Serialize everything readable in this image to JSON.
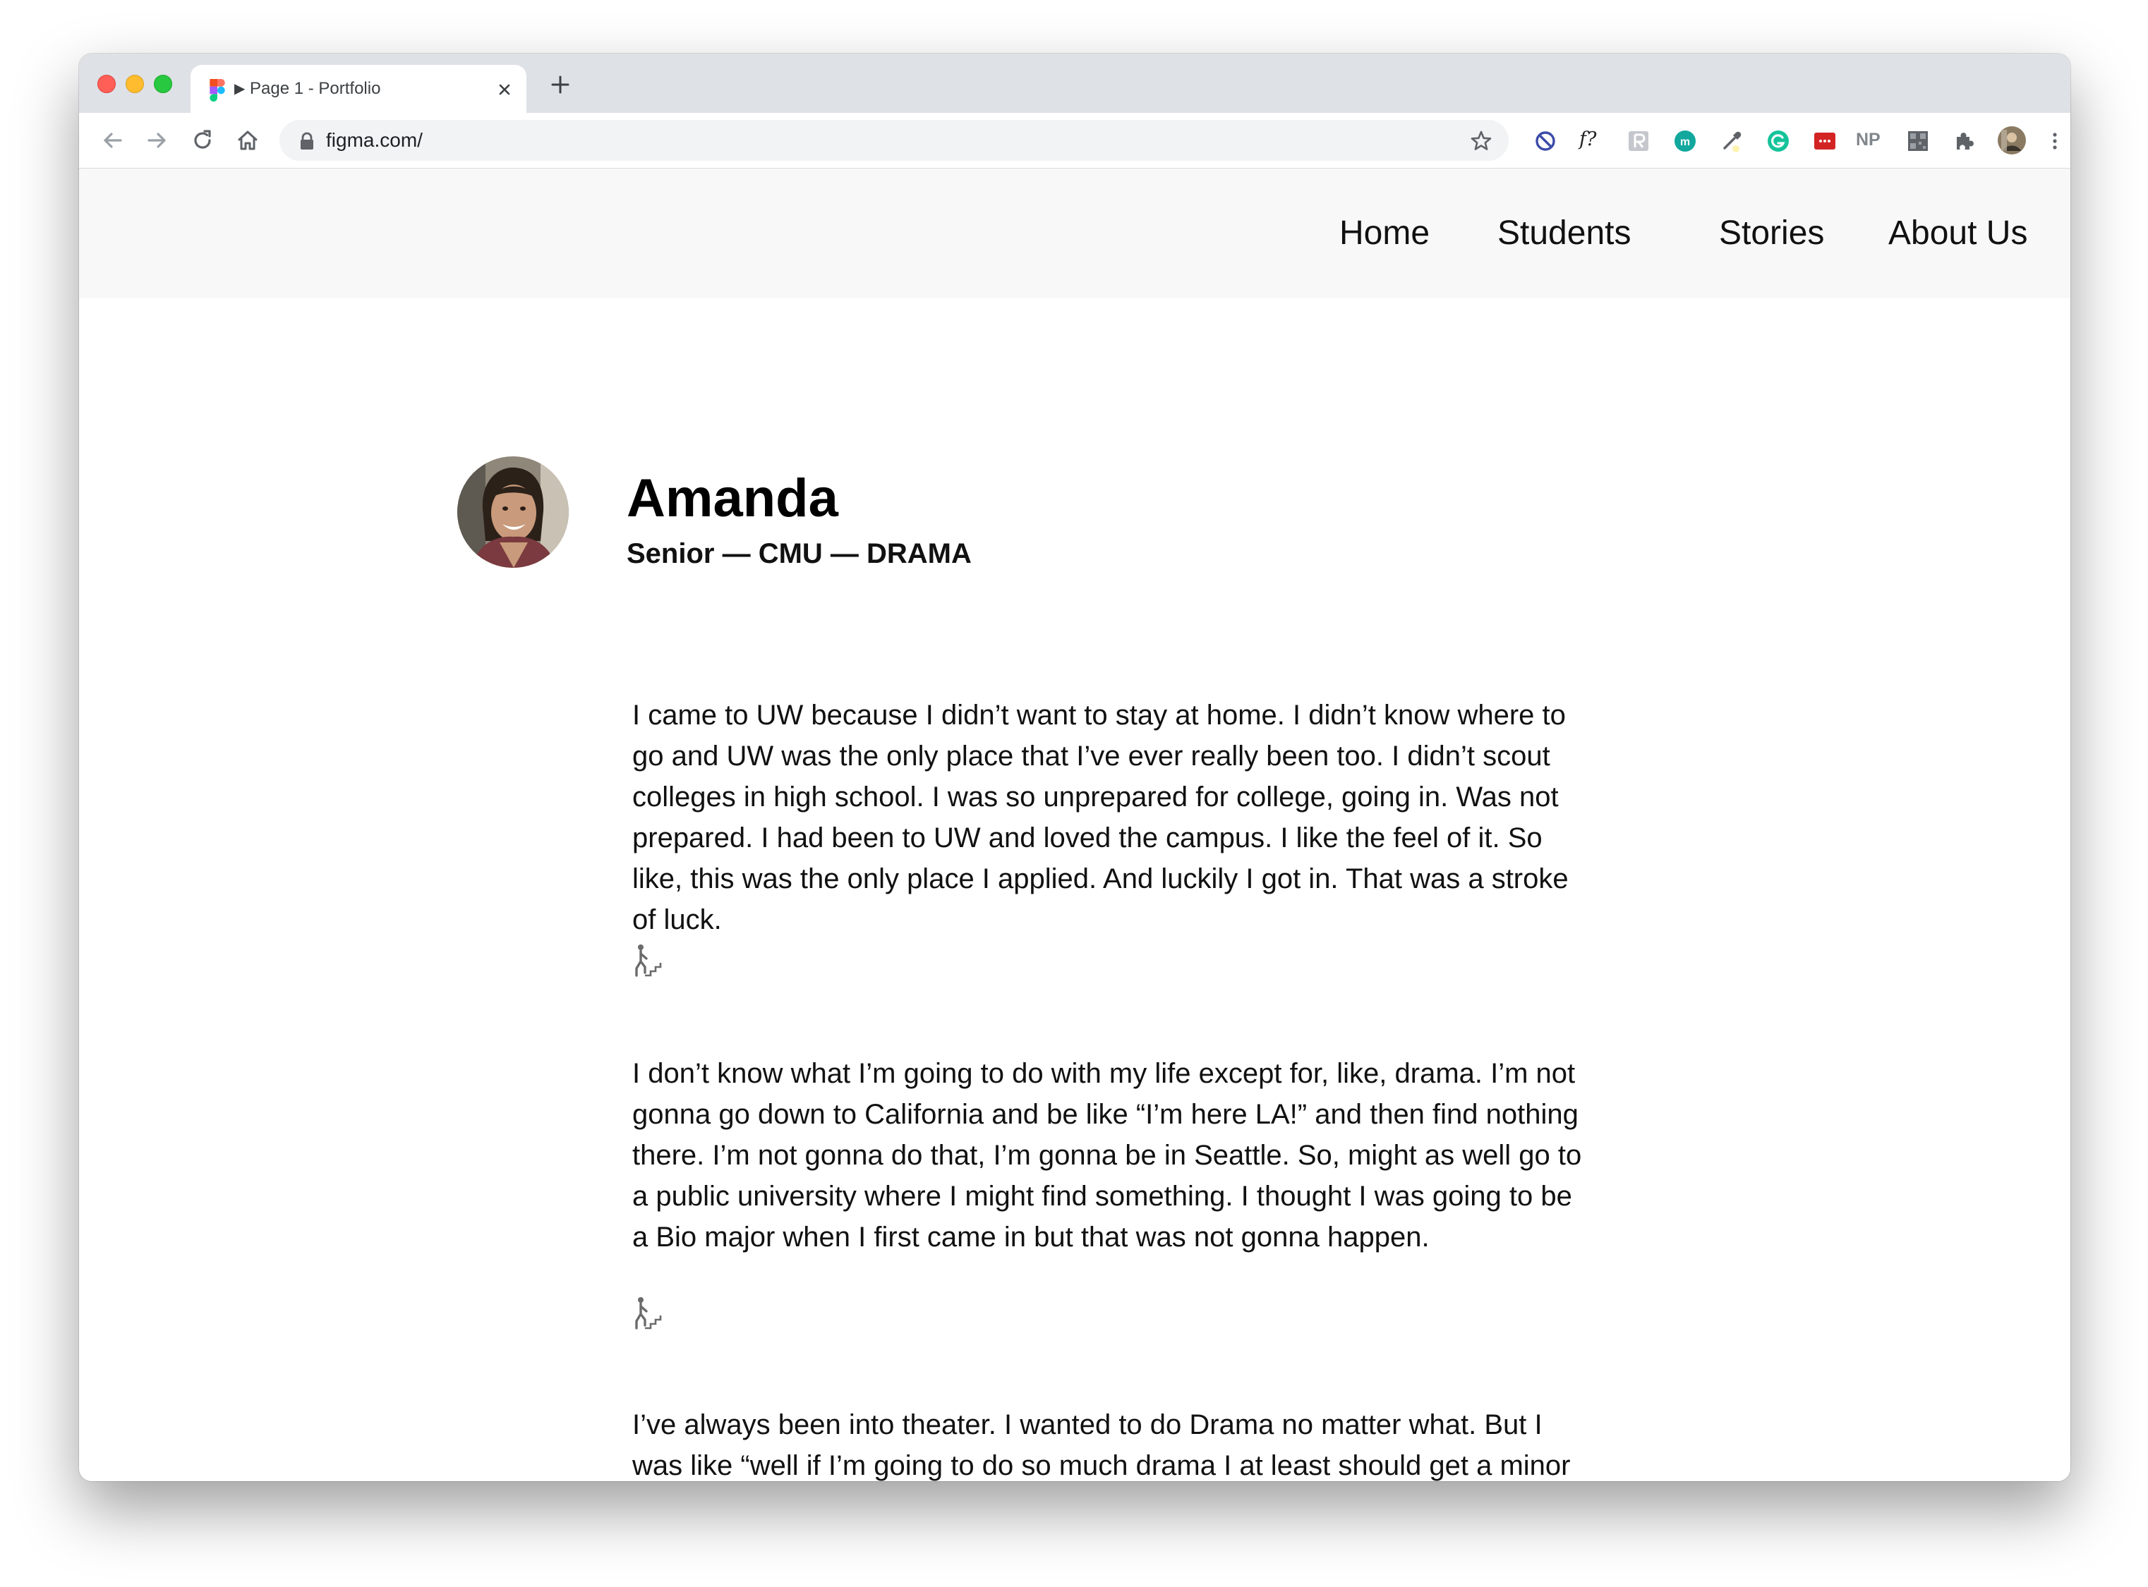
{
  "browser": {
    "tab": {
      "play_glyph": "▶",
      "title": "Page 1 - Portfolio"
    },
    "address_bar": {
      "url": "figma.com/"
    },
    "extensions": {
      "font_ext_label": "f?",
      "np_ext_label": "NP",
      "m_ext_label": "m"
    }
  },
  "site": {
    "nav": {
      "home": "Home",
      "students": "Students",
      "stories": "Stories",
      "about": "About Us"
    },
    "profile": {
      "name": "Amanda",
      "subtitle": "Senior — CMU — DRAMA"
    },
    "paragraphs": [
      "I came to UW because I didn’t want to stay at home. I didn’t know where to go and UW was the only place that I’ve ever really been too. I didn’t scout colleges in high school. I was so unprepared for college, going in. Was not prepared. I had been to UW and loved the campus. I like the feel of it. So like, this was the only place I applied. And luckily I got in. That was a stroke of luck.",
      "I don’t know what I’m going to do with my life except for, like, drama. I’m not gonna go down to California and be like “I’m here LA!” and then find nothing there. I’m not gonna do that, I’m gonna be in Seattle.  So, might as well go to a public university where I might find something. I thought I was going to be a Bio major when I first came in but that was not gonna happen.",
      "I’ve always been into theater. I wanted to do Drama no matter what. But I was like “well if I’m going to do so much drama I at least should get a minor in it.” But they don’t offer a minor in it because it’s too easy"
    ]
  }
}
